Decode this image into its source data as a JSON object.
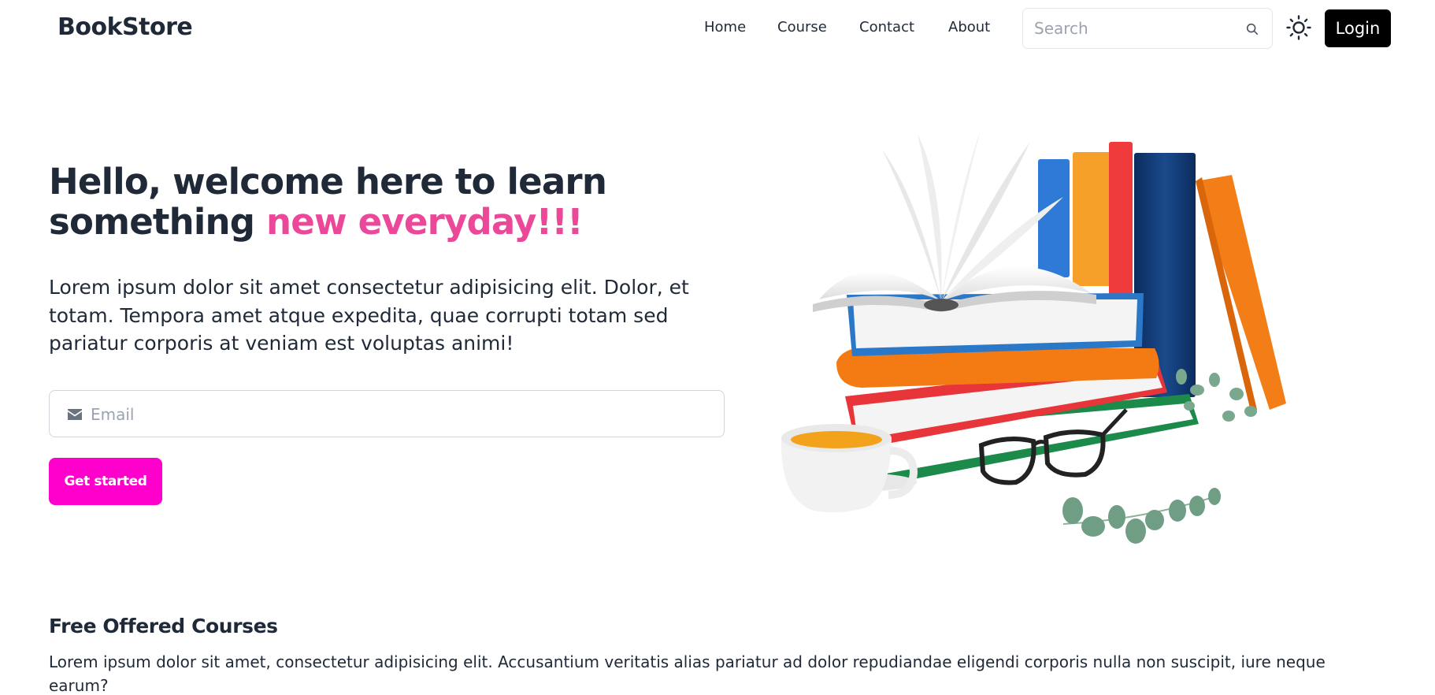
{
  "header": {
    "brand": "BookStore",
    "nav": {
      "home": "Home",
      "course": "Course",
      "contact": "Contact",
      "about": "About"
    },
    "search": {
      "placeholder": "Search",
      "icon": "search-icon"
    },
    "theme_toggle_icon": "sun-icon",
    "login_label": "Login"
  },
  "hero": {
    "title_part1": "Hello, welcome here to learn something ",
    "title_accent": "new everyday!!!",
    "description": "Lorem ipsum dolor sit amet consectetur adipisicing elit. Dolor, et totam. Tempora amet atque expedita, quae corrupti totam sed pariatur corporis at veniam est voluptas animi!",
    "email": {
      "placeholder": "Email",
      "icon": "envelope-icon"
    },
    "cta_label": "Get started",
    "illustration": "stack of books with open book, tea cup, glasses and eucalyptus leaves"
  },
  "courses": {
    "title": "Free Offered Courses",
    "description": "Lorem ipsum dolor sit amet, consectetur adipisicing elit. Accusantium veritatis alias pariatur ad dolor repudiandae eligendi corporis nulla non suscipit, iure neque earum?"
  },
  "colors": {
    "accent_pink": "#ec4899",
    "cta_magenta": "#ff00cc",
    "login_bg": "#000000",
    "text_dark": "#1f2937"
  }
}
